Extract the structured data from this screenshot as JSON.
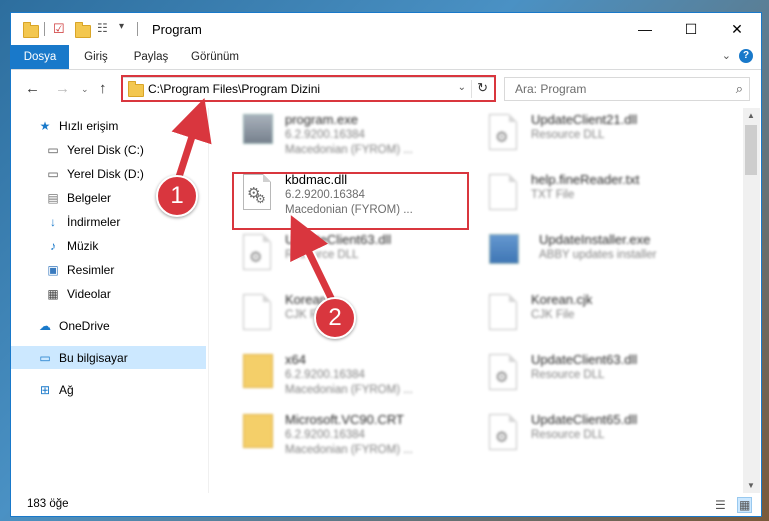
{
  "window": {
    "title": "Program"
  },
  "ribbon": {
    "tabs": [
      "Dosya",
      "Giriş",
      "Paylaş",
      "Görünüm"
    ],
    "help": "?"
  },
  "address": {
    "path": "C:\\Program Files\\Program Dizini"
  },
  "search": {
    "placeholder": "Ara: Program"
  },
  "sidebar": {
    "items": [
      {
        "label": "Hızlı erişim",
        "icon": "star-icon"
      },
      {
        "label": "Yerel Disk (C:)",
        "icon": "drive-icon",
        "pinned": true
      },
      {
        "label": "Yerel Disk (D:)",
        "icon": "drive-icon",
        "pinned": true
      },
      {
        "label": "Belgeler",
        "icon": "documents-icon",
        "pinned": true
      },
      {
        "label": "İndirmeler",
        "icon": "downloads-icon",
        "pinned": true
      },
      {
        "label": "Müzik",
        "icon": "music-icon",
        "pinned": true
      },
      {
        "label": "Resimler",
        "icon": "pictures-icon",
        "pinned": true
      },
      {
        "label": "Videolar",
        "icon": "videos-icon",
        "pinned": true
      },
      {
        "label": "OneDrive",
        "icon": "cloud-icon"
      },
      {
        "label": "Bu bilgisayar",
        "icon": "computer-icon",
        "selected": true
      },
      {
        "label": "Ağ",
        "icon": "network-icon"
      }
    ]
  },
  "files": {
    "left": [
      {
        "name": "program.exe",
        "line2": "6.2.9200.16384",
        "line3": "Macedonian (FYROM) ...",
        "icon": "installer-icon"
      },
      {
        "name": "kbdmac.dll",
        "line2": "6.2.9200.16384",
        "line3": "Macedonian (FYROM) ...",
        "icon": "dll-icon"
      },
      {
        "name": "UpdateClient63.dll",
        "line2": "Resource DLL",
        "line3": "",
        "icon": "dll-icon"
      },
      {
        "name": "Korean",
        "line2": "CJK File",
        "line3": "",
        "icon": "document-icon"
      },
      {
        "name": "x64",
        "line2": "6.2.9200.16384",
        "line3": "Macedonian (FYROM) ...",
        "icon": "folder-icon"
      },
      {
        "name": "Microsoft.VC90.CRT",
        "line2": "6.2.9200.16384",
        "line3": "Macedonian (FYROM) ...",
        "icon": "folder-icon"
      }
    ],
    "right": [
      {
        "name": "UpdateClient21.dll",
        "line2": "Resource DLL",
        "line3": "",
        "icon": "dll-icon"
      },
      {
        "name": "help.fineReader.txt",
        "line2": "TXT File",
        "line3": "",
        "icon": "document-icon"
      },
      {
        "name": "UpdateInstaller.exe",
        "line2": "ABBY updates installer",
        "line3": "",
        "icon": "exe-icon"
      },
      {
        "name": "Korean.cjk",
        "line2": "CJK File",
        "line3": "",
        "icon": "document-icon"
      },
      {
        "name": "UpdateClient63.dll",
        "line2": "Resource DLL",
        "line3": "",
        "icon": "dll-icon"
      },
      {
        "name": "UpdateClient65.dll",
        "line2": "Resource DLL",
        "line3": "",
        "icon": "dll-icon"
      }
    ]
  },
  "status": {
    "count": "183 öğe"
  },
  "callouts": {
    "one": "1",
    "two": "2"
  },
  "colors": {
    "accent": "#1979ca",
    "highlight": "#d9363e",
    "selected_bg": "#cce8ff"
  }
}
